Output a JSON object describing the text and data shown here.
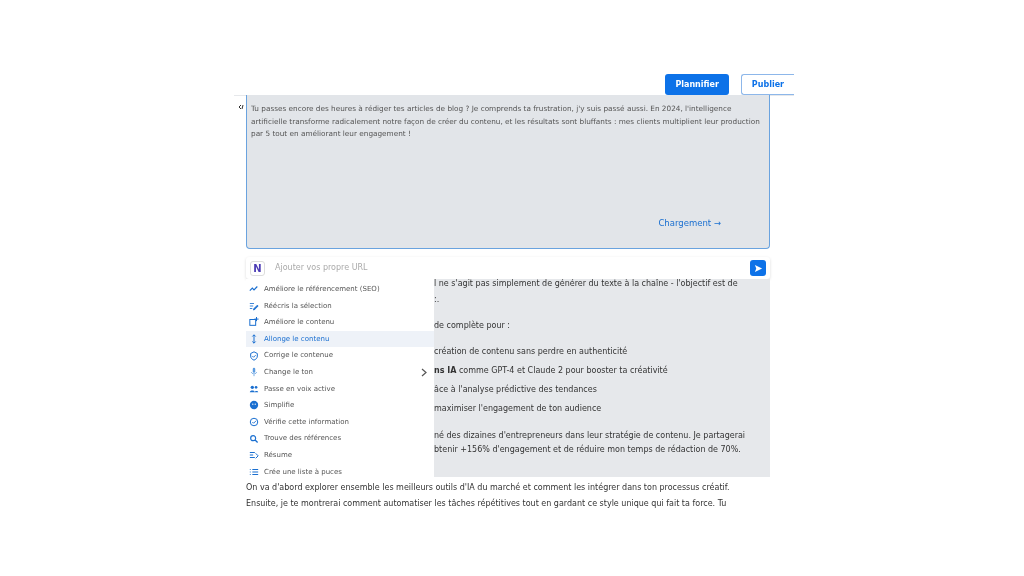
{
  "header": {
    "buttons": [
      {
        "label": "Plannifier",
        "kind": "primary"
      },
      {
        "label": "Publier",
        "kind": "outline"
      }
    ]
  },
  "editor": {
    "text": "Tu passes encore des heures à rédiger tes articles de blog ? Je comprends ta frustration, j'y suis passé aussi. En 2024, l'intelligence artificielle transforme radicalement notre façon de créer du contenu, et les résultats sont bluffants : mes clients multiplient leur production par 5 tout en améliorant leur engagement !",
    "status": "Chargement →"
  },
  "url_bar": {
    "placeholder": "Ajouter vos propre URL",
    "logo": "N"
  },
  "menu": [
    {
      "label": "Améliore le référencement (SEO)",
      "selected": false
    },
    {
      "label": "Réécris la sélection",
      "selected": false
    },
    {
      "label": "Améliore le contenu",
      "selected": false
    },
    {
      "label": "Allonge le contenu",
      "selected": true
    },
    {
      "label": "Corrige le contenue",
      "selected": false
    },
    {
      "label": "Change le ton",
      "selected": false,
      "submenu": true
    },
    {
      "label": "Passe en voix active",
      "selected": false
    },
    {
      "label": "Simplifie",
      "selected": false
    },
    {
      "label": "Vérifie cette information",
      "selected": false
    },
    {
      "label": "Trouve des références",
      "selected": false
    },
    {
      "label": "Résume",
      "selected": false
    },
    {
      "label": "Crée une liste à puces",
      "selected": false
    }
  ],
  "article_fragments": [
    "l ne s'agit pas simplement de générer du texte à la chaîne - l'objectif est de",
    ":.",
    "de complète pour :",
    "création de contenu sans perdre en authenticité",
    "**ns IA** comme GPT-4 et Claude 2 pour booster ta créativité",
    "âce à l'analyse prédictive des tendances",
    "maximiser l'engagement de ton audience",
    "né des dizaines d'entrepreneurs dans leur stratégie de contenu. Je partagerai",
    "btenir +156% d'engagement et de réduire mon temps de rédaction de 70%."
  ],
  "article_paragraph": [
    "On va d'abord explorer ensemble les meilleurs outils d'IA du marché et comment les intégrer dans ton processus créatif.",
    "Ensuite, je te montrerai comment automatiser les tâches répétitives tout en gardant ce style unique qui fait ta force. Tu"
  ]
}
